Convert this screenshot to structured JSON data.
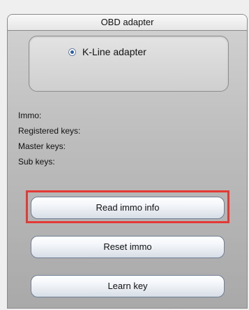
{
  "panel": {
    "title": "OBD adapter",
    "adapter_option": "K-Line adapter"
  },
  "info": {
    "immo_label": "Immo:",
    "registered_keys_label": "Registered keys:",
    "master_keys_label": "Master keys:",
    "sub_keys_label": "Sub keys:"
  },
  "buttons": {
    "read_immo": "Read immo info",
    "reset_immo": "Reset immo",
    "learn_key": "Learn key"
  },
  "colors": {
    "highlight": "#e53935"
  }
}
